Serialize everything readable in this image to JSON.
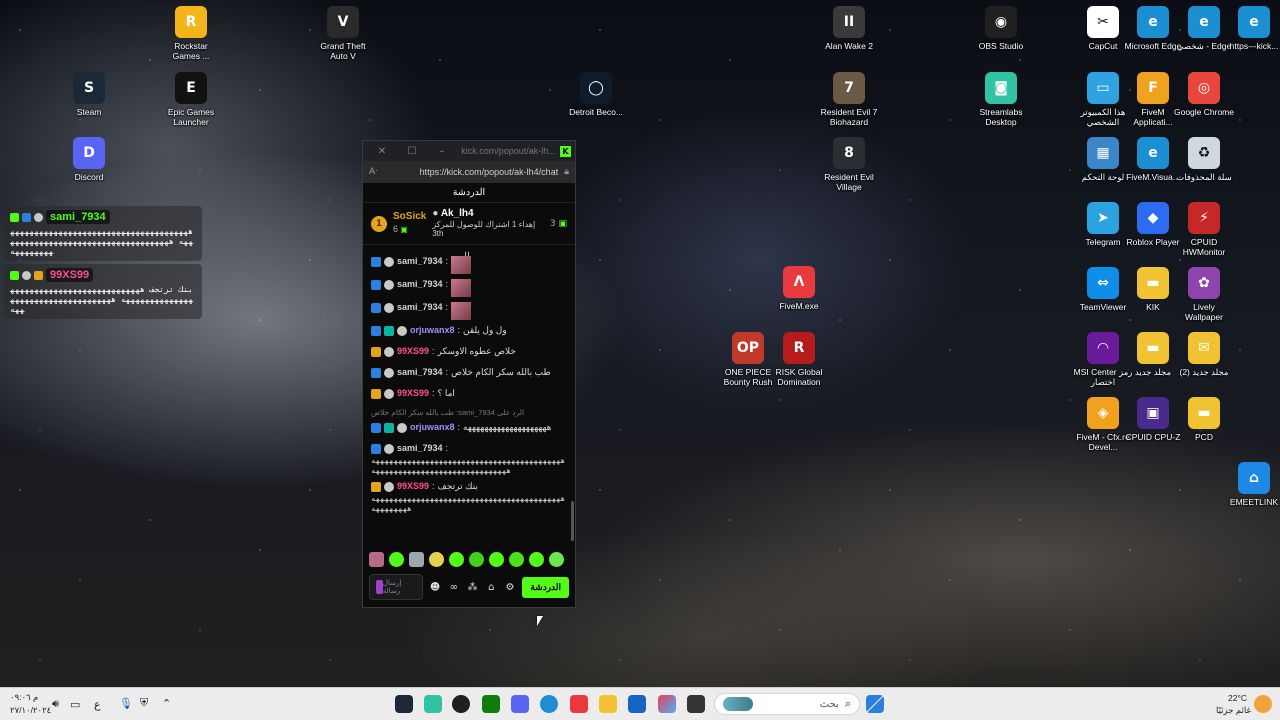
{
  "desktop_icons": [
    {
      "id": "rockstar",
      "label": "Rockstar Games ...",
      "icon": "rockstar-icon",
      "color": "#f5b41a",
      "glyph": "R"
    },
    {
      "id": "gta",
      "label": "Grand Theft Auto V",
      "icon": "gta-icon",
      "color": "#2a2a2a",
      "glyph": "V"
    },
    {
      "id": "steam",
      "label": "Steam",
      "icon": "steam-icon",
      "color": "#1b2838",
      "glyph": "S"
    },
    {
      "id": "epic",
      "label": "Epic Games Launcher",
      "icon": "epic-icon",
      "color": "#111111",
      "glyph": "E"
    },
    {
      "id": "discord",
      "label": "Discord",
      "icon": "discord-icon",
      "color": "#5865f2",
      "glyph": "D"
    },
    {
      "id": "detroit",
      "label": "Detroit Beco...",
      "icon": "detroit-icon",
      "color": "#0d1b2a",
      "glyph": "◯"
    },
    {
      "id": "alanwake",
      "label": "Alan Wake 2",
      "icon": "alan-wake-icon",
      "color": "#3a3a3a",
      "glyph": "II"
    },
    {
      "id": "re7",
      "label": "Resident Evil 7 Biohazard",
      "icon": "resident-evil-7-icon",
      "color": "#6b5a43",
      "glyph": "7"
    },
    {
      "id": "re8",
      "label": "Resident Evil Village",
      "icon": "resident-evil-village-icon",
      "color": "#2b2f33",
      "glyph": "8"
    },
    {
      "id": "fivemexe",
      "label": "FiveM.exe",
      "icon": "fivem-exe-icon",
      "color": "#e8393d",
      "glyph": "Λ"
    },
    {
      "id": "onepiece",
      "label": "ONE PIECE Bounty Rush",
      "icon": "one-piece-icon",
      "color": "#c0392b",
      "glyph": "OP"
    },
    {
      "id": "risk",
      "label": "RISK Global Domination",
      "icon": "risk-icon",
      "color": "#b71c1c",
      "glyph": "R"
    },
    {
      "id": "obs",
      "label": "OBS Studio",
      "icon": "obs-icon",
      "color": "#202020",
      "glyph": "◉"
    },
    {
      "id": "streamlabs",
      "label": "Streamlabs Desktop",
      "icon": "streamlabs-icon",
      "color": "#31c3a2",
      "glyph": "◙"
    },
    {
      "id": "capcut",
      "label": "CapCut",
      "icon": "capcut-icon",
      "color": "#ffffff",
      "glyph": "✂"
    },
    {
      "id": "edge1",
      "label": "Microsoft Edge",
      "icon": "edge-icon",
      "color": "#1b8fd1",
      "glyph": "e"
    },
    {
      "id": "edge2",
      "label": "شخصي - Edge",
      "icon": "edge-personal-icon",
      "color": "#1b8fd1",
      "glyph": "e"
    },
    {
      "id": "edge3",
      "label": "https---kick...",
      "icon": "edge-kick-shortcut-icon",
      "color": "#1b8fd1",
      "glyph": "e"
    },
    {
      "id": "thispc",
      "label": "هذا الكمبيوتر الشخصي",
      "icon": "this-pc-icon",
      "color": "#2ea3e0",
      "glyph": "▭"
    },
    {
      "id": "fivemapp",
      "label": "FiveM Applicati...",
      "icon": "fivem-app-icon",
      "color": "#f0a21e",
      "glyph": "F"
    },
    {
      "id": "chrome",
      "label": "Google Chrome",
      "icon": "chrome-icon",
      "color": "#e8453c",
      "glyph": "◎"
    },
    {
      "id": "control",
      "label": "لوحة التحكم",
      "icon": "control-panel-icon",
      "color": "#3a86c8",
      "glyph": "▦"
    },
    {
      "id": "fivemvisual",
      "label": "FiveM.Visua...",
      "icon": "fivem-visual-icon",
      "color": "#1b8fd1",
      "glyph": "e"
    },
    {
      "id": "recycle",
      "label": "سلة المحذوفات",
      "icon": "recycle-bin-icon",
      "color": "#cfd8dc",
      "glyph": "♻"
    },
    {
      "id": "telegram",
      "label": "Telegram",
      "icon": "telegram-icon",
      "color": "#2aa3e0",
      "glyph": "➤"
    },
    {
      "id": "roblox",
      "label": "Roblox Player",
      "icon": "roblox-icon",
      "color": "#2d6cf0",
      "glyph": "◆"
    },
    {
      "id": "hwmonitor",
      "label": "CPUID HWMonitor",
      "icon": "hwmonitor-icon",
      "color": "#c62828",
      "glyph": "⚡"
    },
    {
      "id": "teamviewer",
      "label": "TeamViewer",
      "icon": "teamviewer-icon",
      "color": "#0e8ee9",
      "glyph": "⇔"
    },
    {
      "id": "kik",
      "label": "KIK",
      "icon": "folder-kik-icon",
      "color": "#f1c232",
      "glyph": "▬"
    },
    {
      "id": "lively",
      "label": "Lively Wallpaper",
      "icon": "lively-icon",
      "color": "#8e44ad",
      "glyph": "✿"
    },
    {
      "id": "msi",
      "label": "MSI Center رمز اختصار",
      "icon": "msi-center-icon",
      "color": "#6a1b9a",
      "glyph": "◠"
    },
    {
      "id": "newfolder",
      "label": "مجلد جديد",
      "icon": "new-folder-icon",
      "color": "#f1c232",
      "glyph": "▬"
    },
    {
      "id": "newfolder2",
      "label": "(2) مجلد جديد",
      "icon": "new-folder-2-icon",
      "color": "#f1c232",
      "glyph": "✉"
    },
    {
      "id": "fivemdev",
      "label": "FiveM - Cfx.re Devel...",
      "icon": "fivem-dev-icon",
      "color": "#f0a21e",
      "glyph": "◈"
    },
    {
      "id": "cpuz",
      "label": "CPUID CPU-Z",
      "icon": "cpuz-icon",
      "color": "#4a2b8c",
      "glyph": "▣"
    },
    {
      "id": "pcd",
      "label": "PCD",
      "icon": "pcd-folder-icon",
      "color": "#f1c232",
      "glyph": "▬"
    },
    {
      "id": "emeetlink",
      "label": "EMEETLINK",
      "icon": "emeetlink-icon",
      "color": "#1e88e5",
      "glyph": "⌂"
    }
  ],
  "overlay": [
    {
      "user": "sami_7934",
      "user_color": "#53fc18",
      "text": "ههههههههههههههههههههههههههههههههههههههههه ههههههههههههههههههههههههههههههههههههههههههه"
    },
    {
      "user": "99XS99",
      "user_color": "#ff4f8c",
      "text": "بنك ترتجف ههههههههههههههههههههههههههههههههههههههههههه ههههههههههههههههههههههههه"
    }
  ],
  "window": {
    "title": "kick.com/popout/ak-lh...",
    "url": "https://kick.com/popout/ak-lh4/chat",
    "reader_icon": "Aᐧ",
    "chat_title": "الدردشة"
  },
  "pinned": {
    "left_user": "SoSick",
    "left_count": "6",
    "left_rank": "1",
    "middle_user": "Ak_lh4",
    "middle_text": "إهداء 1 اشتراك للوصول للمركز",
    "middle_rank": "3th",
    "right_count": "3"
  },
  "messages": [
    {
      "user": "sami_7934",
      "cls": "u-sami",
      "text": "",
      "emote": true,
      "badges": [
        "blue",
        "skull"
      ]
    },
    {
      "user": "sami_7934",
      "cls": "u-sami",
      "text": "",
      "emote": true,
      "badges": [
        "blue",
        "skull"
      ]
    },
    {
      "user": "sami_7934",
      "cls": "u-sami",
      "text": "",
      "emote": true,
      "badges": [
        "blue",
        "skull"
      ]
    },
    {
      "user": "orjuwanx8",
      "cls": "u-orj",
      "text": "ول ول يلقن",
      "emote": false,
      "badges": [
        "blue",
        "teal",
        "skull"
      ]
    },
    {
      "user": "99XS99",
      "cls": "u-99",
      "text": "خلاص عطوه الاوسكر",
      "emote": false,
      "badges": [
        "gold",
        "skull"
      ]
    },
    {
      "user": "sami_7934",
      "cls": "u-sami",
      "text": "طب بالله سكر الكام خلاص",
      "emote": false,
      "badges": [
        "blue",
        "skull"
      ]
    },
    {
      "user": "99XS99",
      "cls": "u-99",
      "text": "اما ؟",
      "emote": false,
      "badges": [
        "gold",
        "skull"
      ]
    }
  ],
  "reply_line": "الرد على sami_7934: طب بالله سكر الكام خلاص",
  "reply_message": {
    "user": "orjuwanx8",
    "text": "ههههههههههههههههههههه"
  },
  "long_messages": [
    {
      "user": "sami_7934",
      "cls": "u-sami",
      "text": "ههههههههههههههههههههههههههههههههههههههههههه ههههههههههههههههههههههههههههههه"
    },
    {
      "user": "99XS99",
      "cls": "u-99",
      "text": "بنك ترتجف",
      "continued": "ههههههههههههههههههههههههههههههههههههههههههه ههههههههه"
    }
  ],
  "input": {
    "placeholder": "إرسال رسالة",
    "send_label": "الدردشة"
  },
  "taskbar": {
    "search_placeholder": "بحث",
    "weather_temp": "22°C",
    "weather_desc": "غائم جزئيًا",
    "clock_time": "م ٠٩:٠٦",
    "clock_date": "٢٧/١٠/٢٠٢٤",
    "lang": "ع"
  }
}
